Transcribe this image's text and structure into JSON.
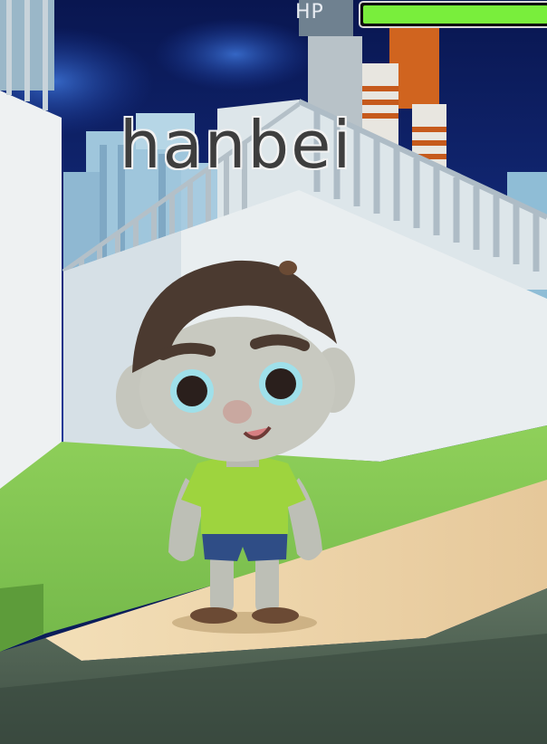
{
  "hud": {
    "hp_label": "HP",
    "hp_fraction": 1.0
  },
  "player": {
    "name": "hanbei"
  },
  "colors": {
    "sky": "#0b1d5a",
    "grass": "#8cc95a",
    "path": "#ecd3a4",
    "hp_fill": "#79ee3c",
    "shirt": "#9ed43e",
    "shorts": "#2f4d86",
    "hair": "#4b3a30",
    "skin": "#c8c9c0"
  }
}
